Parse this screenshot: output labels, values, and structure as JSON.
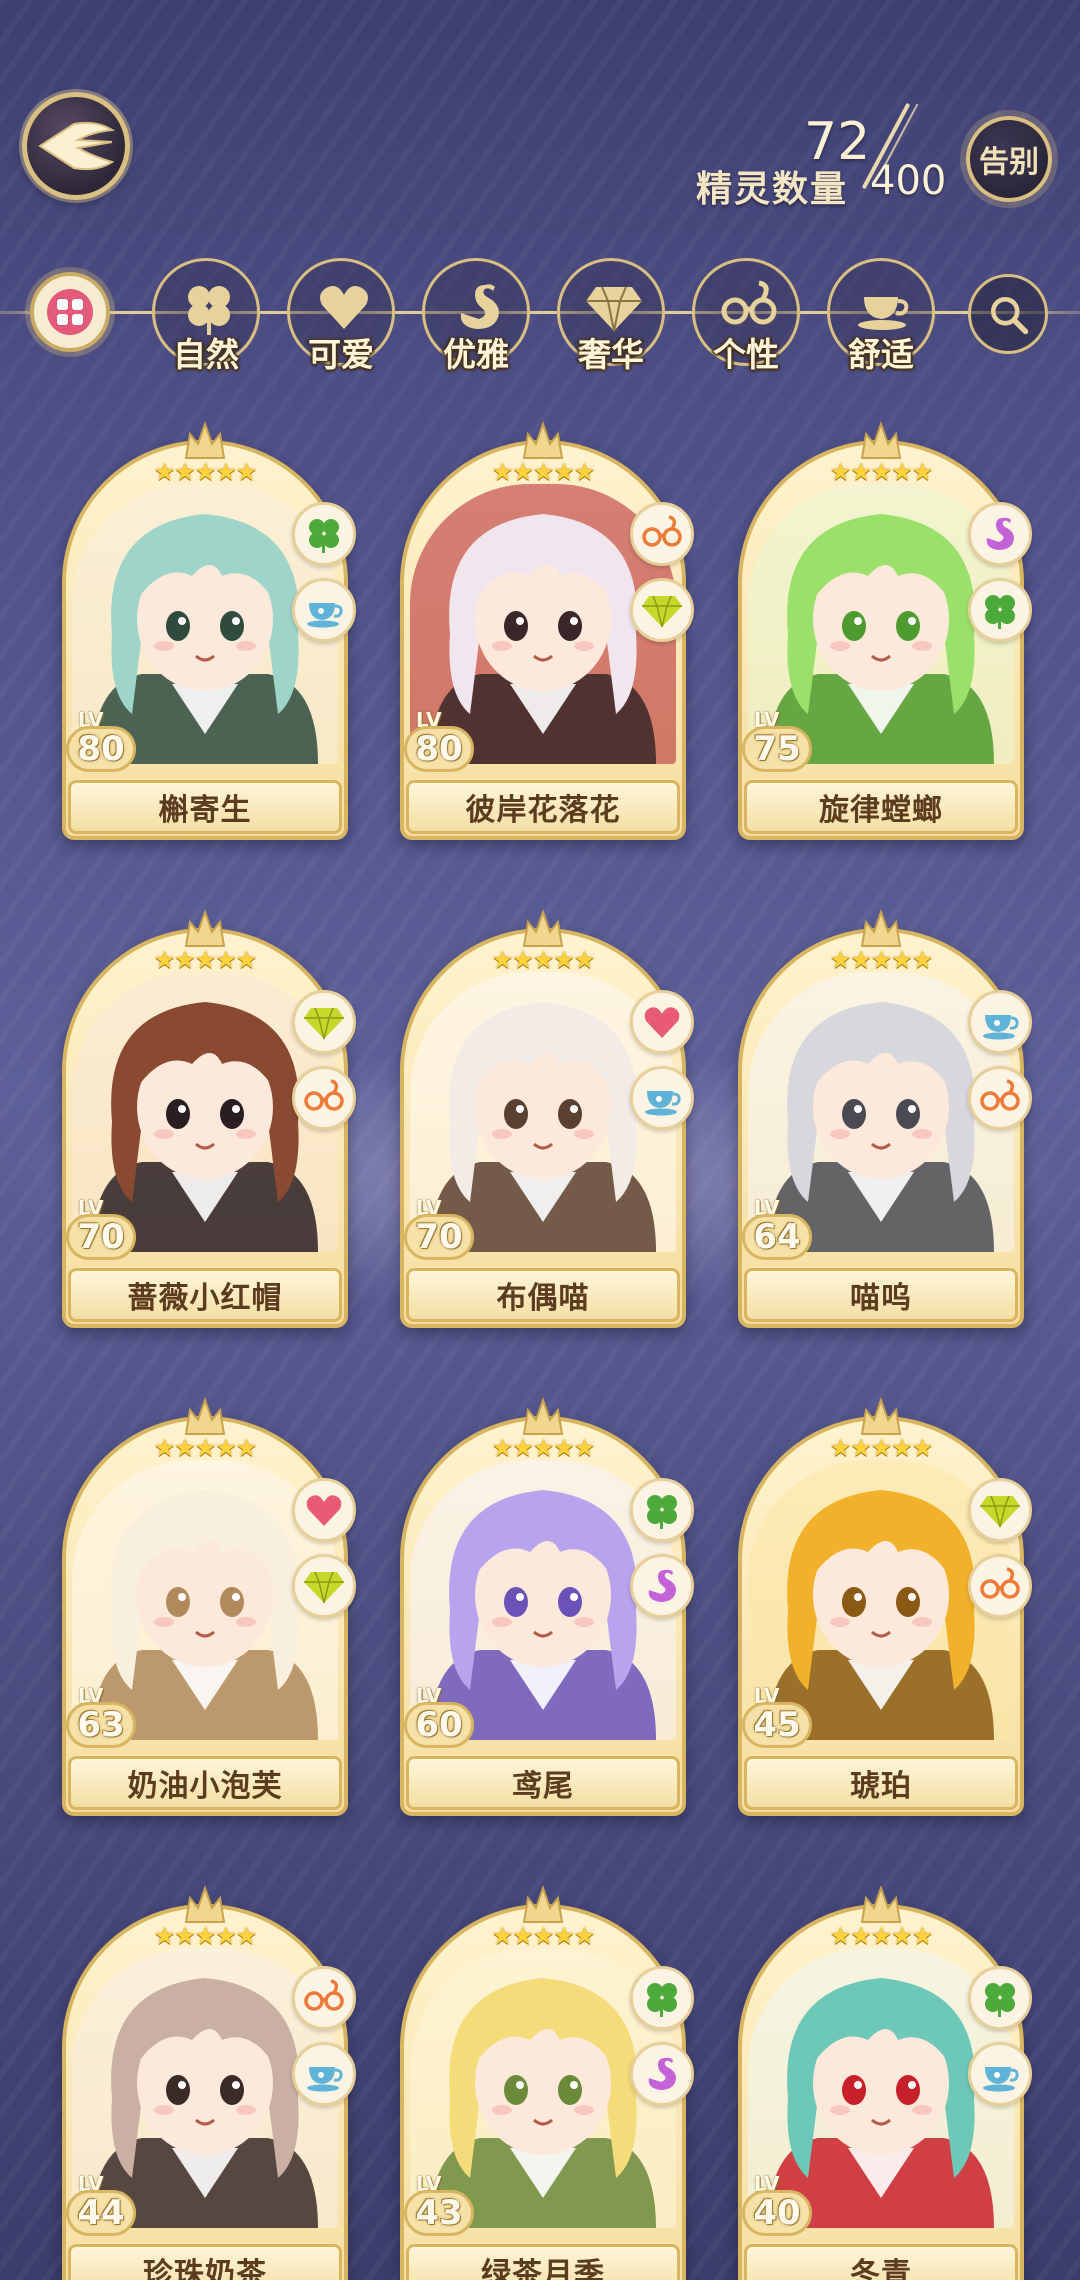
{
  "header": {
    "back_icon": "back-wing-icon",
    "counter_label": "精灵数量",
    "counter_current": "72",
    "counter_max": "400",
    "farewell_label": "告别"
  },
  "filters": {
    "all_icon": "grid-all-icon",
    "items": [
      {
        "label": "自然",
        "icon": "clover-icon",
        "color": "#d9c082"
      },
      {
        "label": "可爱",
        "icon": "heart-icon",
        "color": "#d9c082"
      },
      {
        "label": "优雅",
        "icon": "swan-icon",
        "color": "#d9c082"
      },
      {
        "label": "奢华",
        "icon": "diamond-icon",
        "color": "#d9c082"
      },
      {
        "label": "个性",
        "icon": "glasses-icon",
        "color": "#d9c082"
      },
      {
        "label": "舒适",
        "icon": "teacup-icon",
        "color": "#d9c082"
      }
    ],
    "search_icon": "search-icon"
  },
  "cards": [
    {
      "name": "槲寄生",
      "lv_label": "LV",
      "level": "80",
      "stars": "★★★★★",
      "badges": [
        "clover-icon",
        "teacup-icon"
      ],
      "palette": [
        "#9fd4c8",
        "#f7efe0",
        "#2e4b3e"
      ]
    },
    {
      "name": "彼岸花落花",
      "lv_label": "LV",
      "level": "80",
      "stars": "★★★★★",
      "badges": [
        "glasses-icon",
        "diamond-icon"
      ],
      "palette": [
        "#f1e6ee",
        "#b22030",
        "#3a2628"
      ]
    },
    {
      "name": "旋律螳螂",
      "lv_label": "LV",
      "level": "75",
      "stars": "★★★★★",
      "badges": [
        "swan-icon",
        "clover-icon"
      ],
      "palette": [
        "#9be06a",
        "#eaf7d4",
        "#4d9a2e"
      ]
    },
    {
      "name": "蔷薇小红帽",
      "lv_label": "LV",
      "level": "70",
      "stars": "★★★★★",
      "badges": [
        "diamond-icon",
        "glasses-icon"
      ],
      "palette": [
        "#8a4a32",
        "#fae8d8",
        "#2a1e22"
      ]
    },
    {
      "name": "布偶喵",
      "lv_label": "LV",
      "level": "70",
      "stars": "★★★★★",
      "badges": [
        "heart-icon",
        "teacup-icon"
      ],
      "palette": [
        "#f3ebe6",
        "#fffaf6",
        "#5a4030"
      ]
    },
    {
      "name": "喵呜",
      "lv_label": "LV",
      "level": "64",
      "stars": "★★★★★",
      "badges": [
        "teacup-icon",
        "glasses-icon"
      ],
      "palette": [
        "#d8d8dc",
        "#f6f6f8",
        "#4a4a52"
      ]
    },
    {
      "name": "奶油小泡芙",
      "lv_label": "LV",
      "level": "63",
      "stars": "★★★★★",
      "badges": [
        "heart-icon",
        "diamond-icon"
      ],
      "palette": [
        "#f8efdc",
        "#fffaf0",
        "#b08a5a"
      ]
    },
    {
      "name": "鸢尾",
      "lv_label": "LV",
      "level": "60",
      "stars": "★★★★★",
      "badges": [
        "clover-icon",
        "swan-icon"
      ],
      "palette": [
        "#b8a4ec",
        "#f8f4fe",
        "#6a52b8"
      ]
    },
    {
      "name": "琥珀",
      "lv_label": "LV",
      "level": "45",
      "stars": "★★★★★",
      "badges": [
        "diamond-icon",
        "glasses-icon"
      ],
      "palette": [
        "#f2b12a",
        "#fbe7a8",
        "#8a5a14"
      ]
    },
    {
      "name": "珍珠奶茶",
      "lv_label": "LV",
      "level": "44",
      "stars": "★★★★★",
      "badges": [
        "glasses-icon",
        "teacup-icon"
      ],
      "palette": [
        "#c9b0a2",
        "#f8efe8",
        "#3a2a28"
      ]
    },
    {
      "name": "绿茶月季",
      "lv_label": "LV",
      "level": "43",
      "stars": "★★★★★",
      "badges": [
        "clover-icon",
        "swan-icon"
      ],
      "palette": [
        "#f4dc7a",
        "#fdf6d8",
        "#6a8a3a"
      ]
    },
    {
      "name": "冬青",
      "lv_label": "LV",
      "level": "40",
      "stars": "★★★★★",
      "badges": [
        "clover-icon",
        "teacup-icon"
      ],
      "palette": [
        "#6ec8b8",
        "#eef8f4",
        "#c8202a"
      ]
    }
  ]
}
